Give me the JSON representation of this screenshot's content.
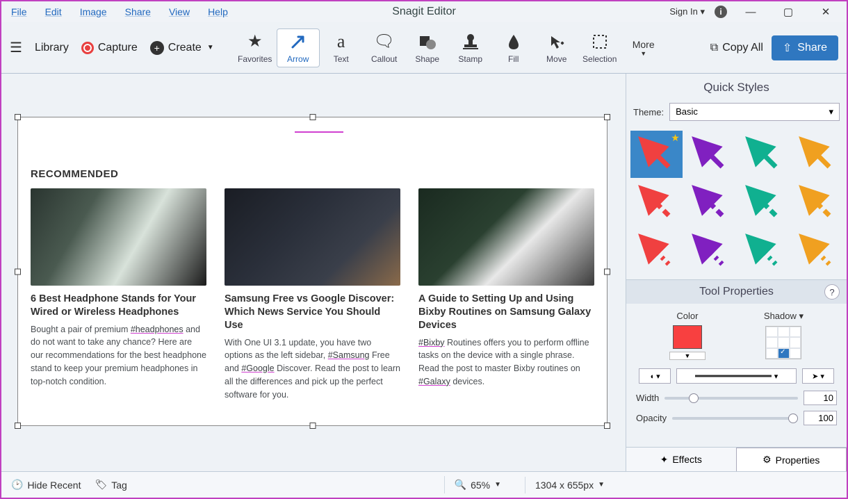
{
  "menubar": {
    "items": [
      "File",
      "Edit",
      "Image",
      "Share",
      "View",
      "Help"
    ],
    "title": "Snagit Editor",
    "signin": "Sign In  ▾"
  },
  "toolbar": {
    "library": "Library",
    "capture": "Capture",
    "create": "Create",
    "tools": [
      {
        "name": "favorites",
        "label": "Favorites"
      },
      {
        "name": "arrow",
        "label": "Arrow"
      },
      {
        "name": "text",
        "label": "Text"
      },
      {
        "name": "callout",
        "label": "Callout"
      },
      {
        "name": "shape",
        "label": "Shape"
      },
      {
        "name": "stamp",
        "label": "Stamp"
      },
      {
        "name": "fill",
        "label": "Fill"
      },
      {
        "name": "move",
        "label": "Move"
      },
      {
        "name": "selection",
        "label": "Selection"
      }
    ],
    "more": "More",
    "copyall": "Copy All",
    "share": "Share"
  },
  "canvas": {
    "recommended": "RECOMMENDED",
    "articles": [
      {
        "title": "6 Best Headphone Stands for Your Wired or Wireless Headphones",
        "preText": "Bought a pair of premium ",
        "link": "#headphones",
        "postText": " and do not want to take any chance? Here are our recommendations for the best headphone stand to keep your premium headphones in top-notch condition."
      },
      {
        "title": "Samsung Free vs Google Discover: Which News Service You Should Use",
        "preText": "With One UI 3.1 update, you have two options as the left sidebar, ",
        "link": "#Samsung",
        "midText": " Free and ",
        "link2": "#Google",
        "postText": " Discover. Read the post to learn all the differences and pick up the perfect software for you."
      },
      {
        "title": "A Guide to Setting Up and Using Bixby Routines on Samsung Galaxy Devices",
        "preLink": "#Bixby",
        "midText": " Routines offers you to perform offline tasks on the device with a single phrase. Read the post to master Bixby routines on ",
        "link2": "#Galaxy",
        "postText": " devices."
      }
    ]
  },
  "panel": {
    "quickstyles": "Quick Styles",
    "theme_label": "Theme:",
    "theme_value": "Basic",
    "styles": [
      {
        "color": "#f04040",
        "variant": "solid",
        "active": true
      },
      {
        "color": "#8020c0",
        "variant": "solid"
      },
      {
        "color": "#10b090",
        "variant": "solid"
      },
      {
        "color": "#f0a020",
        "variant": "solid"
      },
      {
        "color": "#f04040",
        "variant": "dashed-thick"
      },
      {
        "color": "#8020c0",
        "variant": "dashed-thick"
      },
      {
        "color": "#10b090",
        "variant": "dashed-thick"
      },
      {
        "color": "#f0a020",
        "variant": "dashed-thick"
      },
      {
        "color": "#f04040",
        "variant": "dotted"
      },
      {
        "color": "#8020c0",
        "variant": "dotted"
      },
      {
        "color": "#10b090",
        "variant": "dotted"
      },
      {
        "color": "#f0a020",
        "variant": "dotted"
      }
    ],
    "toolprops": "Tool Properties",
    "color_label": "Color",
    "shadow_label": "Shadow ▾",
    "color_value": "#f84040",
    "width_label": "Width",
    "width_value": "10",
    "opacity_label": "Opacity",
    "opacity_value": "100",
    "effects_tab": "Effects",
    "properties_tab": "Properties"
  },
  "statusbar": {
    "hide_recent": "Hide Recent",
    "tag": "Tag",
    "zoom": "65%",
    "dimensions": "1304 x 655px"
  }
}
